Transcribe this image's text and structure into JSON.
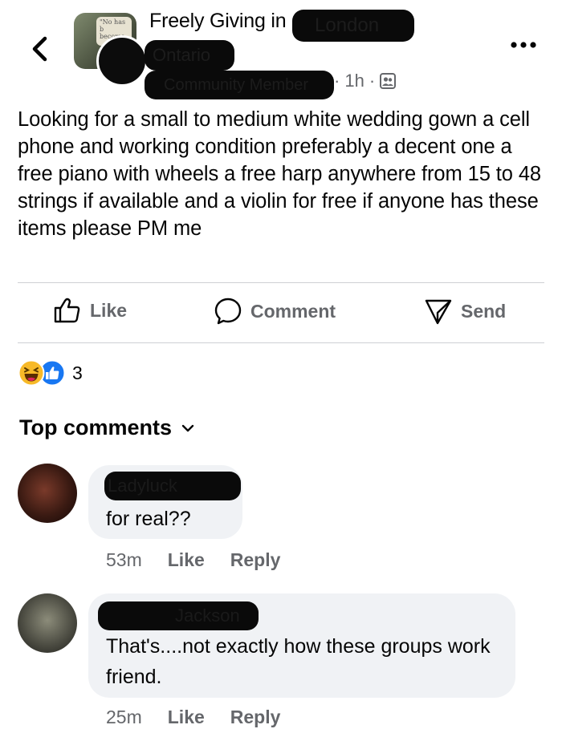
{
  "post": {
    "group_name": "Freely Giving in",
    "group_name_hidden_tail": "London",
    "group_location_hidden": "Ontario",
    "author_name_hidden": "Community Member",
    "time": "1h",
    "separator": "·",
    "group_avatar_text": "\"No has b become",
    "privacy_icon": "members-icon",
    "text": "Looking for a small to medium white wedding gown a cell phone and working condition preferably a decent one a free piano with wheels a free harp anywhere from 15 to 48 strings if available and a violin for free if anyone has these items please PM me"
  },
  "actions": {
    "like": "Like",
    "comment": "Comment",
    "send": "Send"
  },
  "reactions": {
    "count": "3",
    "icons": [
      "haha-icon",
      "like-icon"
    ],
    "colors": {
      "like": "#1877f2",
      "haha": "#f7b928"
    }
  },
  "comments_section": {
    "title": "Top comments",
    "comments": [
      {
        "author_hidden": "Ladyluck",
        "text": "for real??",
        "time": "53m",
        "like": "Like",
        "reply": "Reply"
      },
      {
        "author_hidden": "Jackson",
        "text": "That's....not exactly how these groups work friend.",
        "time": "25m",
        "like": "Like",
        "reply": "Reply"
      }
    ]
  }
}
